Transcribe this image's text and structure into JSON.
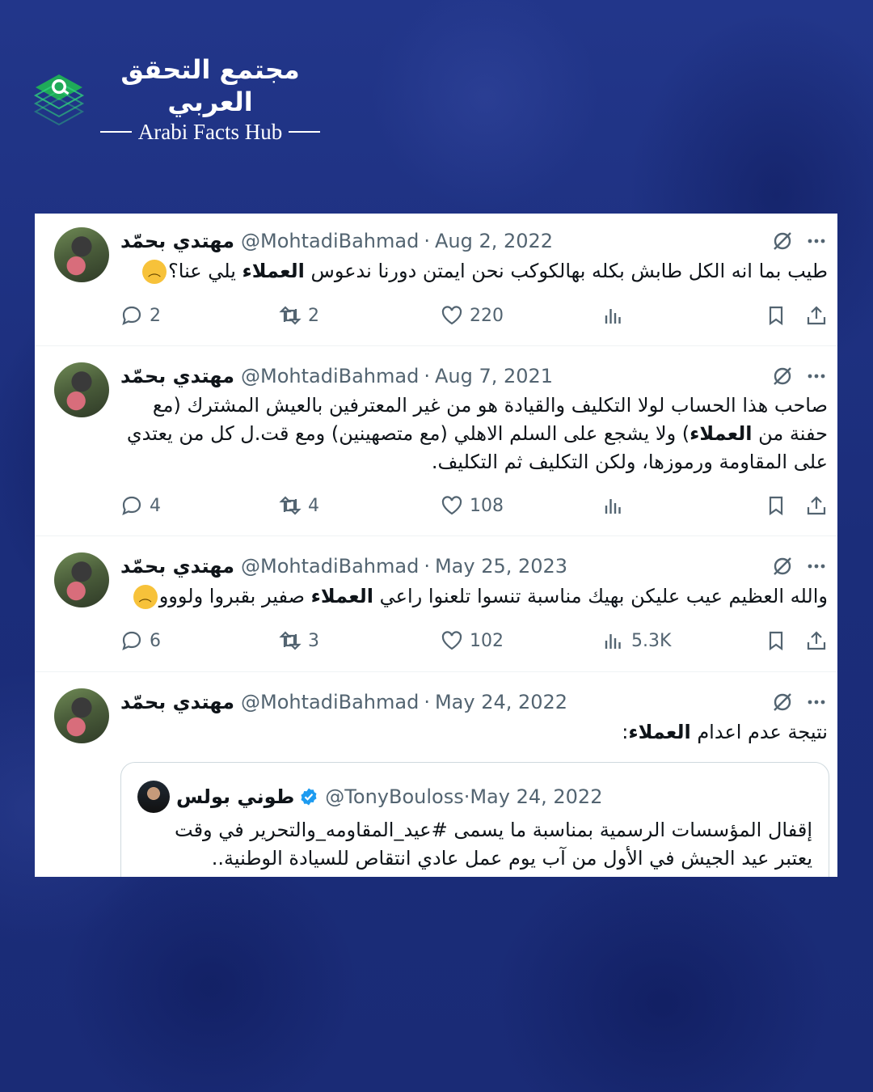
{
  "brand": {
    "name_ar": "مجتمع التحقق العربي",
    "name_en": "Arabi Facts Hub"
  },
  "colors": {
    "background": "#1c2f7e",
    "card": "#ffffff",
    "text_primary": "#0f1419",
    "text_secondary": "#536471",
    "verified": "#1d9bf0",
    "logo_green": "#22c55e"
  },
  "tweets": [
    {
      "name": "مهتدي بحمّد",
      "handle": "@MohtadiBahmad",
      "date": "Aug 2, 2022",
      "text_pre": "طيب بما انه الكل طابش بكله بهالكوكب نحن ايمتن دورنا ندعوس ",
      "text_bold": "العملاء",
      "text_post": " يلي عنا؟",
      "emoji": "disappointed-face",
      "replies": "2",
      "retweets": "2",
      "likes": "220",
      "views": ""
    },
    {
      "name": "مهتدي بحمّد",
      "handle": "@MohtadiBahmad",
      "date": "Aug 7, 2021",
      "text_pre": "صاحب هذا الحساب لولا التكليف والقيادة هو من غير المعترفين بالعيش المشترك (مع حفنة من ",
      "text_bold": "العملاء",
      "text_post": ") ولا يشجع على السلم الاهلي (مع متصهينين) ومع قت.ل كل من يعتدي على المقاومة ورموزها، ولكن التكليف ثم التكليف.",
      "emoji": "",
      "replies": "4",
      "retweets": "4",
      "likes": "108",
      "views": ""
    },
    {
      "name": "مهتدي بحمّد",
      "handle": "@MohtadiBahmad",
      "date": "May 25, 2023",
      "text_pre": "والله العظيم عيب عليكن بهيك مناسبة تنسوا تلعنوا راعي ",
      "text_bold": "العملاء",
      "text_post": " صفير بقبروا ولووو",
      "emoji": "disappointed-face",
      "replies": "6",
      "retweets": "3",
      "likes": "102",
      "views": "5.3K"
    },
    {
      "name": "مهتدي بحمّد",
      "handle": "@MohtadiBahmad",
      "date": "May 24, 2022",
      "text_pre": "نتيجة عدم اعدام ",
      "text_bold": "العملاء",
      "text_post": ":",
      "emoji": "",
      "quote": {
        "name": "طوني بولس",
        "handle": "@TonyBouloss",
        "date": "May 24, 2022",
        "verified": true,
        "text": "إقفال المؤسسات الرسمية بمناسبة ما يسمى #عيد_المقاومه_والتحرير في وقت يعتبر عيد الجيش في الأول من آب يوم عمل عادي انتقاص للسيادة الوطنية.."
      }
    }
  ],
  "icons": {
    "reply": "reply-icon",
    "retweet": "retweet-icon",
    "like": "like-icon",
    "views": "views-icon",
    "bookmark": "bookmark-icon",
    "share": "share-icon",
    "grok": "grok-icon",
    "more": "more-icon"
  }
}
